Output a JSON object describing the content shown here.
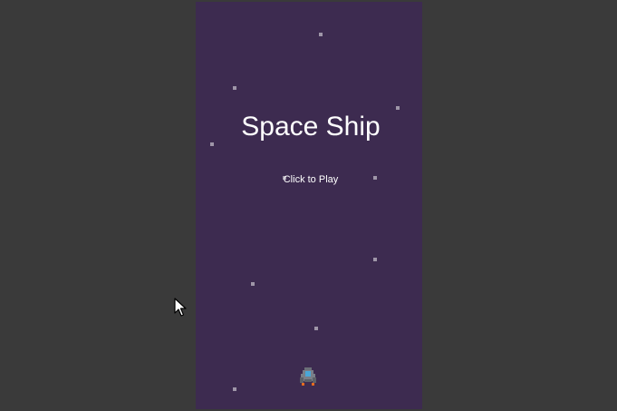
{
  "game": {
    "title": "Space Ship",
    "prompt": "Click to Play"
  },
  "colors": {
    "page_background": "#3a3a3a",
    "canvas_background": "#3d2b50",
    "star": "#9f96a8",
    "text": "#ffffff",
    "ship_body": "#7a7f88",
    "ship_cockpit": "#4aa7d8",
    "ship_flame": "#e46a1f"
  },
  "icons": {
    "player": "spaceship-icon",
    "pointer": "mouse-cursor-icon"
  }
}
